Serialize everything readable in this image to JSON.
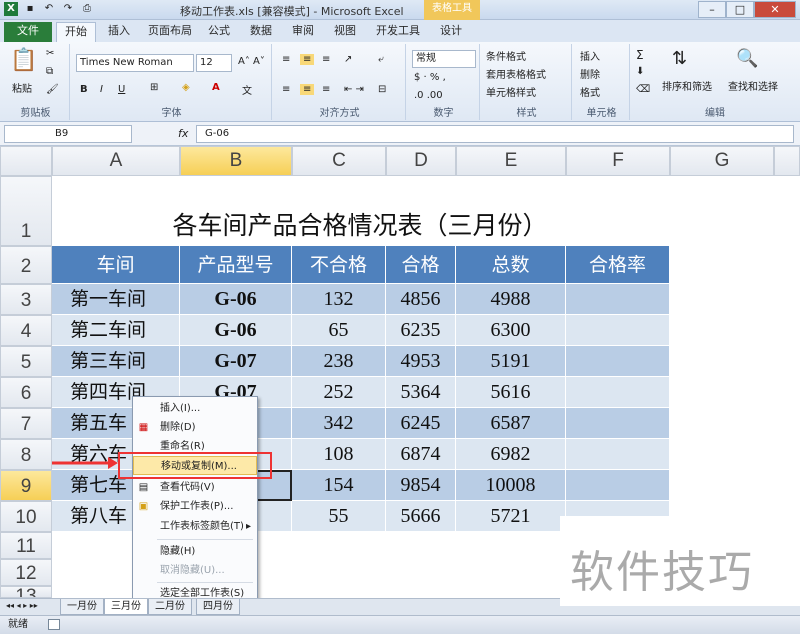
{
  "window": {
    "title": "移动工作表.xls  [兼容模式] - Microsoft Excel",
    "context_tab": "表格工具"
  },
  "ribbon_tabs": [
    "文件",
    "开始",
    "插入",
    "页面布局",
    "公式",
    "数据",
    "审阅",
    "视图",
    "开发工具",
    "设计"
  ],
  "ribbon": {
    "paste": "粘贴",
    "clipboard": "剪贴板",
    "font_name": "Times New Roman",
    "font_size": "12",
    "font": "字体",
    "bold": "B",
    "italic": "I",
    "underline": "U",
    "alignment": "对齐方式",
    "number_format": "常规",
    "number": "数字",
    "cond_format": "条件格式",
    "table_format": "套用表格格式",
    "cell_style": "单元格样式",
    "styles": "样式",
    "insert": "插入",
    "delete": "删除",
    "format": "格式",
    "cells": "单元格",
    "sigma": "Σ",
    "sort_filter": "排序和筛选",
    "find_select": "查找和选择",
    "editing": "编辑"
  },
  "formula_bar": {
    "name_box": "B9",
    "fx": "fx",
    "value": "G-06"
  },
  "columns": [
    "A",
    "B",
    "C",
    "D",
    "E",
    "F",
    "G"
  ],
  "rows": [
    "1",
    "2",
    "3",
    "4",
    "5",
    "6",
    "7",
    "8",
    "9",
    "10",
    "11",
    "12",
    "13"
  ],
  "sheet_title": "各车间产品合格情况表（三月份）",
  "table": {
    "headers": [
      "车间",
      "产品型号",
      "不合格",
      "合格",
      "总数",
      "合格率"
    ],
    "data": [
      [
        "第一车间",
        "G-06",
        "132",
        "4856",
        "4988",
        ""
      ],
      [
        "第二车间",
        "G-06",
        "65",
        "6235",
        "6300",
        ""
      ],
      [
        "第三车间",
        "G-07",
        "238",
        "4953",
        "5191",
        ""
      ],
      [
        "第四车间",
        "G-07",
        "252",
        "5364",
        "5616",
        ""
      ],
      [
        "第五车",
        "",
        "342",
        "6245",
        "6587",
        ""
      ],
      [
        "第六车",
        "",
        "108",
        "6874",
        "6982",
        ""
      ],
      [
        "第七车",
        "",
        "154",
        "9854",
        "10008",
        ""
      ],
      [
        "第八车",
        "",
        "55",
        "5666",
        "5721",
        ""
      ]
    ]
  },
  "context_menu": [
    "插入(I)...",
    "删除(D)",
    "重命名(R)",
    "移动或复制(M)...",
    "查看代码(V)",
    "保护工作表(P)...",
    "工作表标签颜色(T)",
    "隐藏(H)",
    "取消隐藏(U)...",
    "选定全部工作表(S)"
  ],
  "sheet_tabs": [
    "一月份",
    "三月份",
    "二月份",
    "四月份"
  ],
  "status": {
    "ready": "就绪"
  },
  "watermark": "软件技巧",
  "colors": {
    "header_blue": "#4f81bd",
    "row_dark": "#b9cde5",
    "row_light": "#dce6f1",
    "highlight": "#e33333"
  }
}
